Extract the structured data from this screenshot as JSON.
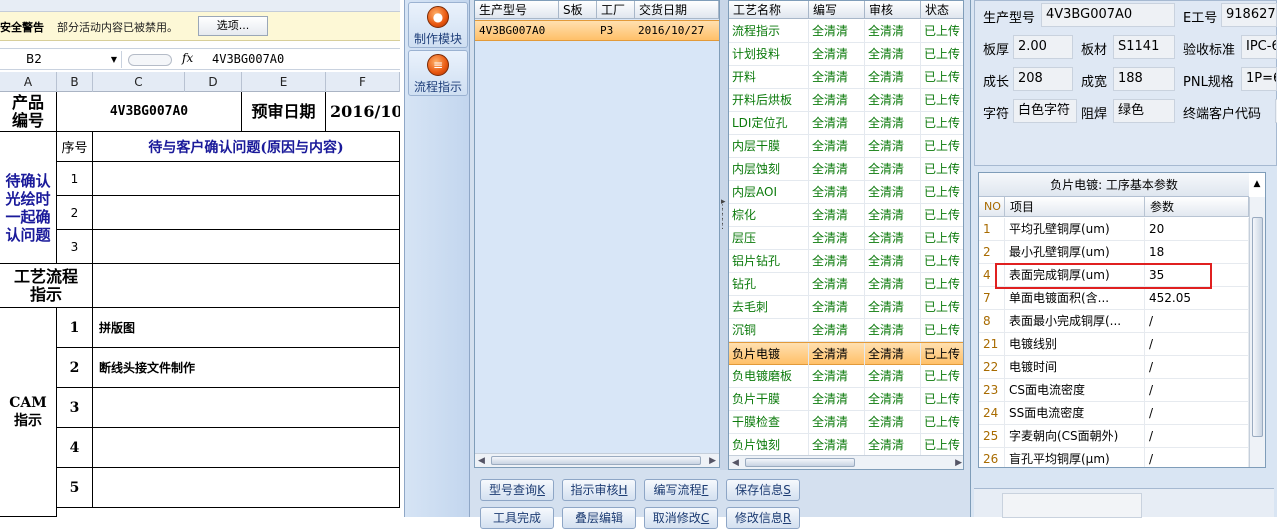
{
  "excel": {
    "security": {
      "title": "安全警告",
      "message": "部分活动内容已被禁用。",
      "options_button": "选项..."
    },
    "namebox": "B2",
    "formula_value": "4V3BG007A0",
    "columns": [
      "A",
      "B",
      "C",
      "D",
      "E",
      "F"
    ],
    "sheet": {
      "product_no_label": "产品\n编号",
      "product_no_value": "4V3BG007A0",
      "review_date_label": "预审日期",
      "review_date_value": "2016/10/",
      "seq_label": "序号",
      "issues_header": "待与客户确认问题(原因与内容)",
      "confirm_label": "待确认\n光绘时\n一起确\n认问题",
      "confirm_rows": [
        "1",
        "2",
        "3"
      ],
      "process_label": "工艺流程\n指示",
      "cam_label": "CAM\n指示",
      "cam_rows": [
        {
          "no": "1",
          "text": "拼版图"
        },
        {
          "no": "2",
          "text": "断线头接文件制作"
        },
        {
          "no": "3",
          "text": ""
        },
        {
          "no": "4",
          "text": ""
        },
        {
          "no": "5",
          "text": ""
        }
      ]
    }
  },
  "tools": [
    {
      "icon": "flame-icon",
      "label": "制作模块"
    },
    {
      "icon": "flow-icon",
      "label": "流程指示"
    }
  ],
  "grid1": {
    "headers": [
      "生产型号",
      "S板",
      "工厂",
      "交货日期"
    ],
    "row": {
      "model": "4V3BG007A0",
      "s": "",
      "factory": "P3",
      "date": "2016/10/27"
    }
  },
  "grid2": {
    "headers": [
      "工艺名称",
      "编写",
      "审核",
      "状态"
    ],
    "selected_index": 14,
    "rows": [
      {
        "name": "流程指示",
        "w": "全清清",
        "r": "全清清",
        "s": "已上传"
      },
      {
        "name": "计划投料",
        "w": "全清清",
        "r": "全清清",
        "s": "已上传"
      },
      {
        "name": "开料",
        "w": "全清清",
        "r": "全清清",
        "s": "已上传"
      },
      {
        "name": "开料后烘板",
        "w": "全清清",
        "r": "全清清",
        "s": "已上传"
      },
      {
        "name": "LDI定位孔",
        "w": "全清清",
        "r": "全清清",
        "s": "已上传"
      },
      {
        "name": "内层干膜",
        "w": "全清清",
        "r": "全清清",
        "s": "已上传"
      },
      {
        "name": "内层蚀刻",
        "w": "全清清",
        "r": "全清清",
        "s": "已上传"
      },
      {
        "name": "内层AOI",
        "w": "全清清",
        "r": "全清清",
        "s": "已上传"
      },
      {
        "name": "棕化",
        "w": "全清清",
        "r": "全清清",
        "s": "已上传"
      },
      {
        "name": "层压",
        "w": "全清清",
        "r": "全清清",
        "s": "已上传"
      },
      {
        "name": "铝片钻孔",
        "w": "全清清",
        "r": "全清清",
        "s": "已上传"
      },
      {
        "name": "钻孔",
        "w": "全清清",
        "r": "全清清",
        "s": "已上传"
      },
      {
        "name": "去毛刺",
        "w": "全清清",
        "r": "全清清",
        "s": "已上传"
      },
      {
        "name": "沉铜",
        "w": "全清清",
        "r": "全清清",
        "s": "已上传"
      },
      {
        "name": "负片电镀",
        "w": "全清清",
        "r": "全清清",
        "s": "已上传"
      },
      {
        "name": "负电镀磨板",
        "w": "全清清",
        "r": "全清清",
        "s": "已上传"
      },
      {
        "name": "负片干膜",
        "w": "全清清",
        "r": "全清清",
        "s": "已上传"
      },
      {
        "name": "干膜检查",
        "w": "全清清",
        "r": "全清清",
        "s": "已上传"
      },
      {
        "name": "负片蚀刻",
        "w": "全清清",
        "r": "全清清",
        "s": "已上传"
      }
    ]
  },
  "buttons_row1": [
    {
      "label": "型号查询",
      "key": "K"
    },
    {
      "label": "指示审核",
      "key": "H"
    },
    {
      "label": "编写流程",
      "key": "F"
    },
    {
      "label": "保存信息",
      "key": "S"
    }
  ],
  "buttons_row2": [
    {
      "label": "工具完成",
      "key": ""
    },
    {
      "label": "叠层编辑",
      "key": ""
    },
    {
      "label": "取消修改",
      "key": "C"
    },
    {
      "label": "修改信息",
      "key": "R"
    }
  ],
  "info": {
    "model_label": "生产型号",
    "model_value": "4V3BG007A0",
    "emp_label": "E工号",
    "emp_value": "918627",
    "thick_label": "板厚",
    "thick_value": "2.00",
    "material_label": "板材",
    "material_value": "S1141",
    "std_label": "验收标准",
    "std_value": "IPC-6",
    "len_label": "成长",
    "len_value": "208",
    "width_label": "成宽",
    "width_value": "188",
    "pnl_label": "PNL规格",
    "pnl_value": "1P=6",
    "char_label": "字符",
    "char_value": "白色字符",
    "mask_label": "阻焊",
    "mask_value": "绿色",
    "customer_label": "终端客户代码",
    "customer_value": ""
  },
  "params": {
    "caption": "负片电镀: 工序基本参数",
    "headers": [
      "NO",
      "项目",
      "参数"
    ],
    "highlight_color": "#e02020",
    "rows": [
      {
        "no": "1",
        "item": "平均孔壁铜厚(um)",
        "val": "20"
      },
      {
        "no": "2",
        "item": "最小孔壁铜厚(um)",
        "val": "18"
      },
      {
        "no": "4",
        "item": "表面完成铜厚(um)",
        "val": "35"
      },
      {
        "no": "7",
        "item": "单面电镀面积(含...",
        "val": "452.05"
      },
      {
        "no": "8",
        "item": "表面最小完成铜厚(...",
        "val": "/"
      },
      {
        "no": "21",
        "item": "电镀线别",
        "val": "/"
      },
      {
        "no": "22",
        "item": "电镀时间",
        "val": "/"
      },
      {
        "no": "23",
        "item": "CS面电流密度",
        "val": "/"
      },
      {
        "no": "24",
        "item": "SS面电流密度",
        "val": "/"
      },
      {
        "no": "25",
        "item": "字麦朝向(CS面朝外)",
        "val": "/"
      },
      {
        "no": "26",
        "item": "盲孔平均铜厚(μm)",
        "val": "/"
      }
    ]
  }
}
